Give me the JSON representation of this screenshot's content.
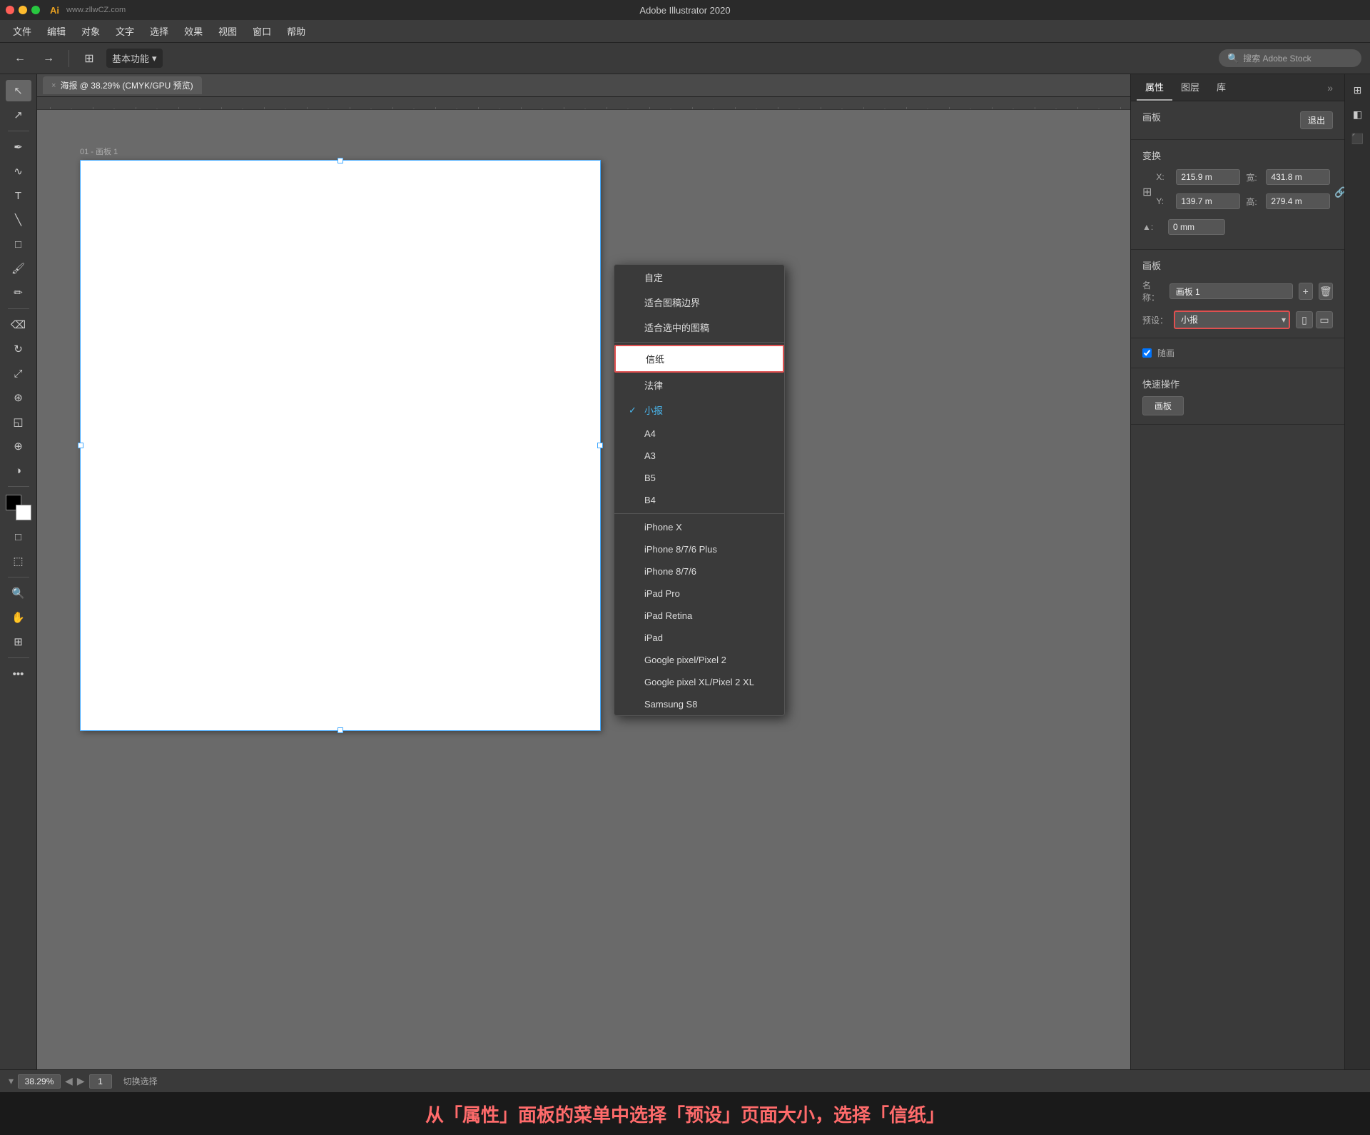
{
  "titlebar": {
    "app_name": "Adobe Illustrator 2020",
    "logo": "Ai",
    "watermark": "www.zllwCZ.com"
  },
  "menubar": {
    "items": [
      "文件",
      "编辑",
      "对象",
      "文字",
      "选择",
      "效果",
      "视图",
      "窗口",
      "帮助"
    ]
  },
  "toolbar": {
    "workspace_label": "基本功能",
    "search_placeholder": "搜索 Adobe Stock"
  },
  "document_tab": {
    "close": "×",
    "title": "海报 @ 38.29% (CMYK/GPU 预览)"
  },
  "artboard": {
    "label": "01 - 画板 1"
  },
  "right_panel": {
    "tabs": [
      "属性",
      "图层",
      "库"
    ],
    "artboard_section": "画板",
    "exit_button": "退出",
    "transform_section": "变换",
    "x_label": "X:",
    "x_value": "215.9 m",
    "width_label": "宽:",
    "width_value": "431.8 m",
    "y_label": "Y:",
    "y_value": "139.7 m",
    "height_label": "高:",
    "height_value": "279.4 m",
    "angle_label": "▲:",
    "angle_value": "0 mm",
    "artboard_label_section": "画板",
    "name_label": "名称：",
    "name_value": "画板 1",
    "preset_label": "预设：",
    "preset_value": "小报",
    "checkbox_label": "随画"
  },
  "dropdown": {
    "items": [
      {
        "label": "自定",
        "selected": false,
        "highlighted": false
      },
      {
        "label": "适合图稿边界",
        "selected": false,
        "highlighted": false
      },
      {
        "label": "适合选中的图稿",
        "selected": false,
        "highlighted": false
      },
      {
        "label": "信纸",
        "selected": false,
        "highlighted": true
      },
      {
        "label": "法律",
        "selected": false,
        "highlighted": false
      },
      {
        "label": "小报",
        "selected": true,
        "highlighted": false
      },
      {
        "label": "A4",
        "selected": false,
        "highlighted": false
      },
      {
        "label": "A3",
        "selected": false,
        "highlighted": false
      },
      {
        "label": "B5",
        "selected": false,
        "highlighted": false
      },
      {
        "label": "B4",
        "selected": false,
        "highlighted": false
      },
      {
        "label": "iPhone X",
        "selected": false,
        "highlighted": false
      },
      {
        "label": "iPhone 8/7/6 Plus",
        "selected": false,
        "highlighted": false
      },
      {
        "label": "iPhone 8/7/6",
        "selected": false,
        "highlighted": false
      },
      {
        "label": "iPad Pro",
        "selected": false,
        "highlighted": false
      },
      {
        "label": "iPad Retina",
        "selected": false,
        "highlighted": false
      },
      {
        "label": "iPad",
        "selected": false,
        "highlighted": false
      },
      {
        "label": "Google pixel/Pixel 2",
        "selected": false,
        "highlighted": false
      },
      {
        "label": "Google pixel XL/Pixel 2 XL",
        "selected": false,
        "highlighted": false
      },
      {
        "label": "Samsung S8",
        "selected": false,
        "highlighted": false
      }
    ]
  },
  "status_bar": {
    "zoom": "38.29%",
    "page": "1",
    "status": "切换选择"
  },
  "bottom_annotation": {
    "text": "从「属性」面板的菜单中选择「预设」页面大小，选择「信纸」"
  },
  "quick_actions": {
    "button": "画板"
  }
}
